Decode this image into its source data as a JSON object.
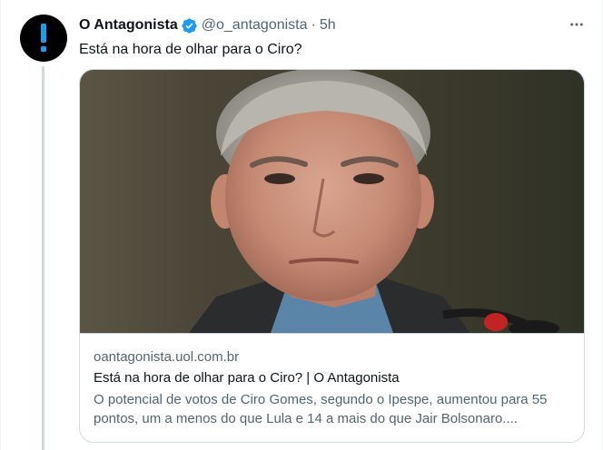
{
  "tweet": {
    "author": {
      "display_name": "O Antagonista",
      "handle": "@o_antagonista",
      "verified_icon": "verified-badge-icon",
      "avatar_icon": "exclamation-icon"
    },
    "separator": "·",
    "time": "5h",
    "text": "Está na hora de olhar para o Ciro?",
    "more_icon": "more-options-icon",
    "card": {
      "image": "portrait-photo",
      "domain": "oantagonista.uol.com.br",
      "title": "Está na hora de olhar para o Ciro? | O Antagonista",
      "description": "O potencial de votos de Ciro Gomes, segundo o Ipespe, aumentou para 55 pontos, um a menos do que Lula e 14 a mais do que Jair Bolsonaro...."
    }
  },
  "colors": {
    "accent": "#1d9bf0",
    "avatar_bg": "#000000",
    "avatar_mark": "#1d9bf0",
    "text_primary": "#0f1419",
    "text_secondary": "#536471",
    "border": "#cfd9de"
  }
}
